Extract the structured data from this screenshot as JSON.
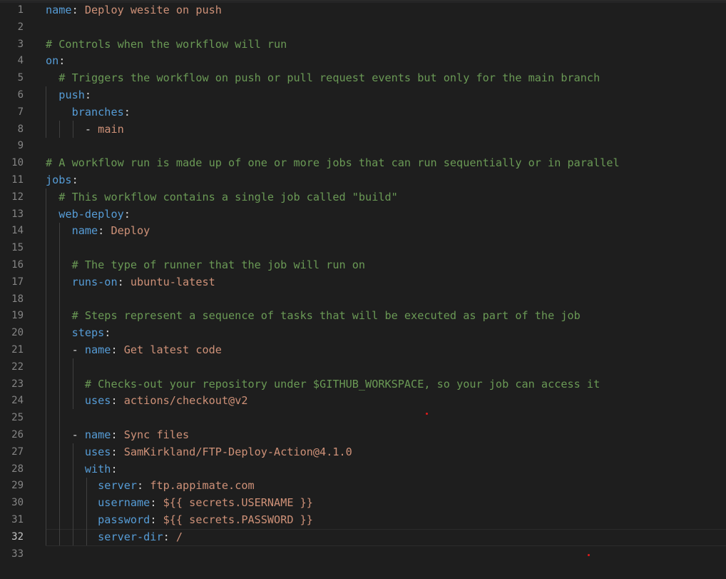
{
  "editor": {
    "language": "yaml",
    "current_line": 32,
    "colors": {
      "background": "#1e1e1e",
      "key": "#569cd6",
      "string": "#ce9178",
      "comment": "#6a9955",
      "plain": "#d4d4d4",
      "line_number": "#858585"
    },
    "lines": [
      {
        "n": "1",
        "indent": "",
        "parts": [
          {
            "t": "k",
            "v": "name"
          },
          {
            "t": "p",
            "v": ": "
          },
          {
            "t": "s",
            "v": "Deploy wesite on push"
          }
        ]
      },
      {
        "n": "2",
        "indent": "",
        "parts": []
      },
      {
        "n": "3",
        "indent": "",
        "parts": [
          {
            "t": "c",
            "v": "# Controls when the workflow will run"
          }
        ]
      },
      {
        "n": "4",
        "indent": "",
        "parts": [
          {
            "t": "k",
            "v": "on"
          },
          {
            "t": "p",
            "v": ":"
          }
        ]
      },
      {
        "n": "5",
        "indent": "  ",
        "parts": [
          {
            "t": "c",
            "v": "# Triggers the workflow on push or pull request events but only for the main branch"
          }
        ]
      },
      {
        "n": "6",
        "indent": "  ",
        "parts": [
          {
            "t": "k",
            "v": "push"
          },
          {
            "t": "p",
            "v": ":"
          }
        ]
      },
      {
        "n": "7",
        "indent": "    ",
        "parts": [
          {
            "t": "k",
            "v": "branches"
          },
          {
            "t": "p",
            "v": ":"
          }
        ]
      },
      {
        "n": "8",
        "indent": "      ",
        "parts": [
          {
            "t": "p",
            "v": "- "
          },
          {
            "t": "s",
            "v": "main"
          }
        ]
      },
      {
        "n": "9",
        "indent": "",
        "parts": []
      },
      {
        "n": "10",
        "indent": "",
        "parts": [
          {
            "t": "c",
            "v": "# A workflow run is made up of one or more jobs that can run sequentially or in parallel"
          }
        ]
      },
      {
        "n": "11",
        "indent": "",
        "parts": [
          {
            "t": "k",
            "v": "jobs"
          },
          {
            "t": "p",
            "v": ":"
          }
        ]
      },
      {
        "n": "12",
        "indent": "  ",
        "parts": [
          {
            "t": "c",
            "v": "# This workflow contains a single job called \"build\""
          }
        ]
      },
      {
        "n": "13",
        "indent": "  ",
        "parts": [
          {
            "t": "k",
            "v": "web-deploy"
          },
          {
            "t": "p",
            "v": ":"
          }
        ]
      },
      {
        "n": "14",
        "indent": "    ",
        "parts": [
          {
            "t": "k",
            "v": "name"
          },
          {
            "t": "p",
            "v": ": "
          },
          {
            "t": "s",
            "v": "Deploy"
          }
        ]
      },
      {
        "n": "15",
        "indent": "",
        "parts": []
      },
      {
        "n": "16",
        "indent": "    ",
        "parts": [
          {
            "t": "c",
            "v": "# The type of runner that the job will run on"
          }
        ]
      },
      {
        "n": "17",
        "indent": "    ",
        "parts": [
          {
            "t": "k",
            "v": "runs-on"
          },
          {
            "t": "p",
            "v": ": "
          },
          {
            "t": "s",
            "v": "ubuntu-latest"
          }
        ]
      },
      {
        "n": "18",
        "indent": "",
        "parts": []
      },
      {
        "n": "19",
        "indent": "    ",
        "parts": [
          {
            "t": "c",
            "v": "# Steps represent a sequence of tasks that will be executed as part of the job"
          }
        ]
      },
      {
        "n": "20",
        "indent": "    ",
        "parts": [
          {
            "t": "k",
            "v": "steps"
          },
          {
            "t": "p",
            "v": ":"
          }
        ]
      },
      {
        "n": "21",
        "indent": "    ",
        "parts": [
          {
            "t": "p",
            "v": "- "
          },
          {
            "t": "k",
            "v": "name"
          },
          {
            "t": "p",
            "v": ": "
          },
          {
            "t": "s",
            "v": "Get latest code"
          }
        ]
      },
      {
        "n": "22",
        "indent": "",
        "parts": []
      },
      {
        "n": "23",
        "indent": "      ",
        "parts": [
          {
            "t": "c",
            "v": "# Checks-out your repository under $GITHUB_WORKSPACE, so your job can access it"
          }
        ]
      },
      {
        "n": "24",
        "indent": "      ",
        "parts": [
          {
            "t": "k",
            "v": "uses"
          },
          {
            "t": "p",
            "v": ": "
          },
          {
            "t": "s",
            "v": "actions/checkout@v2"
          }
        ]
      },
      {
        "n": "25",
        "indent": "",
        "parts": []
      },
      {
        "n": "26",
        "indent": "    ",
        "parts": [
          {
            "t": "p",
            "v": "- "
          },
          {
            "t": "k",
            "v": "name"
          },
          {
            "t": "p",
            "v": ": "
          },
          {
            "t": "s",
            "v": "Sync files"
          }
        ]
      },
      {
        "n": "27",
        "indent": "      ",
        "parts": [
          {
            "t": "k",
            "v": "uses"
          },
          {
            "t": "p",
            "v": ": "
          },
          {
            "t": "s",
            "v": "SamKirkland/FTP-Deploy-Action@4.1.0"
          }
        ]
      },
      {
        "n": "28",
        "indent": "      ",
        "parts": [
          {
            "t": "k",
            "v": "with"
          },
          {
            "t": "p",
            "v": ":"
          }
        ]
      },
      {
        "n": "29",
        "indent": "        ",
        "parts": [
          {
            "t": "k",
            "v": "server"
          },
          {
            "t": "p",
            "v": ": "
          },
          {
            "t": "s",
            "v": "ftp.appimate.com"
          }
        ]
      },
      {
        "n": "30",
        "indent": "        ",
        "parts": [
          {
            "t": "k",
            "v": "username"
          },
          {
            "t": "p",
            "v": ": "
          },
          {
            "t": "s",
            "v": "${{ secrets.USERNAME }}"
          }
        ]
      },
      {
        "n": "31",
        "indent": "        ",
        "parts": [
          {
            "t": "k",
            "v": "password"
          },
          {
            "t": "p",
            "v": ": "
          },
          {
            "t": "s",
            "v": "${{ secrets.PASSWORD }}"
          }
        ]
      },
      {
        "n": "32",
        "indent": "        ",
        "parts": [
          {
            "t": "k",
            "v": "server-dir"
          },
          {
            "t": "p",
            "v": ": "
          },
          {
            "t": "s",
            "v": "/"
          }
        ]
      },
      {
        "n": "33",
        "indent": "",
        "parts": []
      }
    ]
  }
}
